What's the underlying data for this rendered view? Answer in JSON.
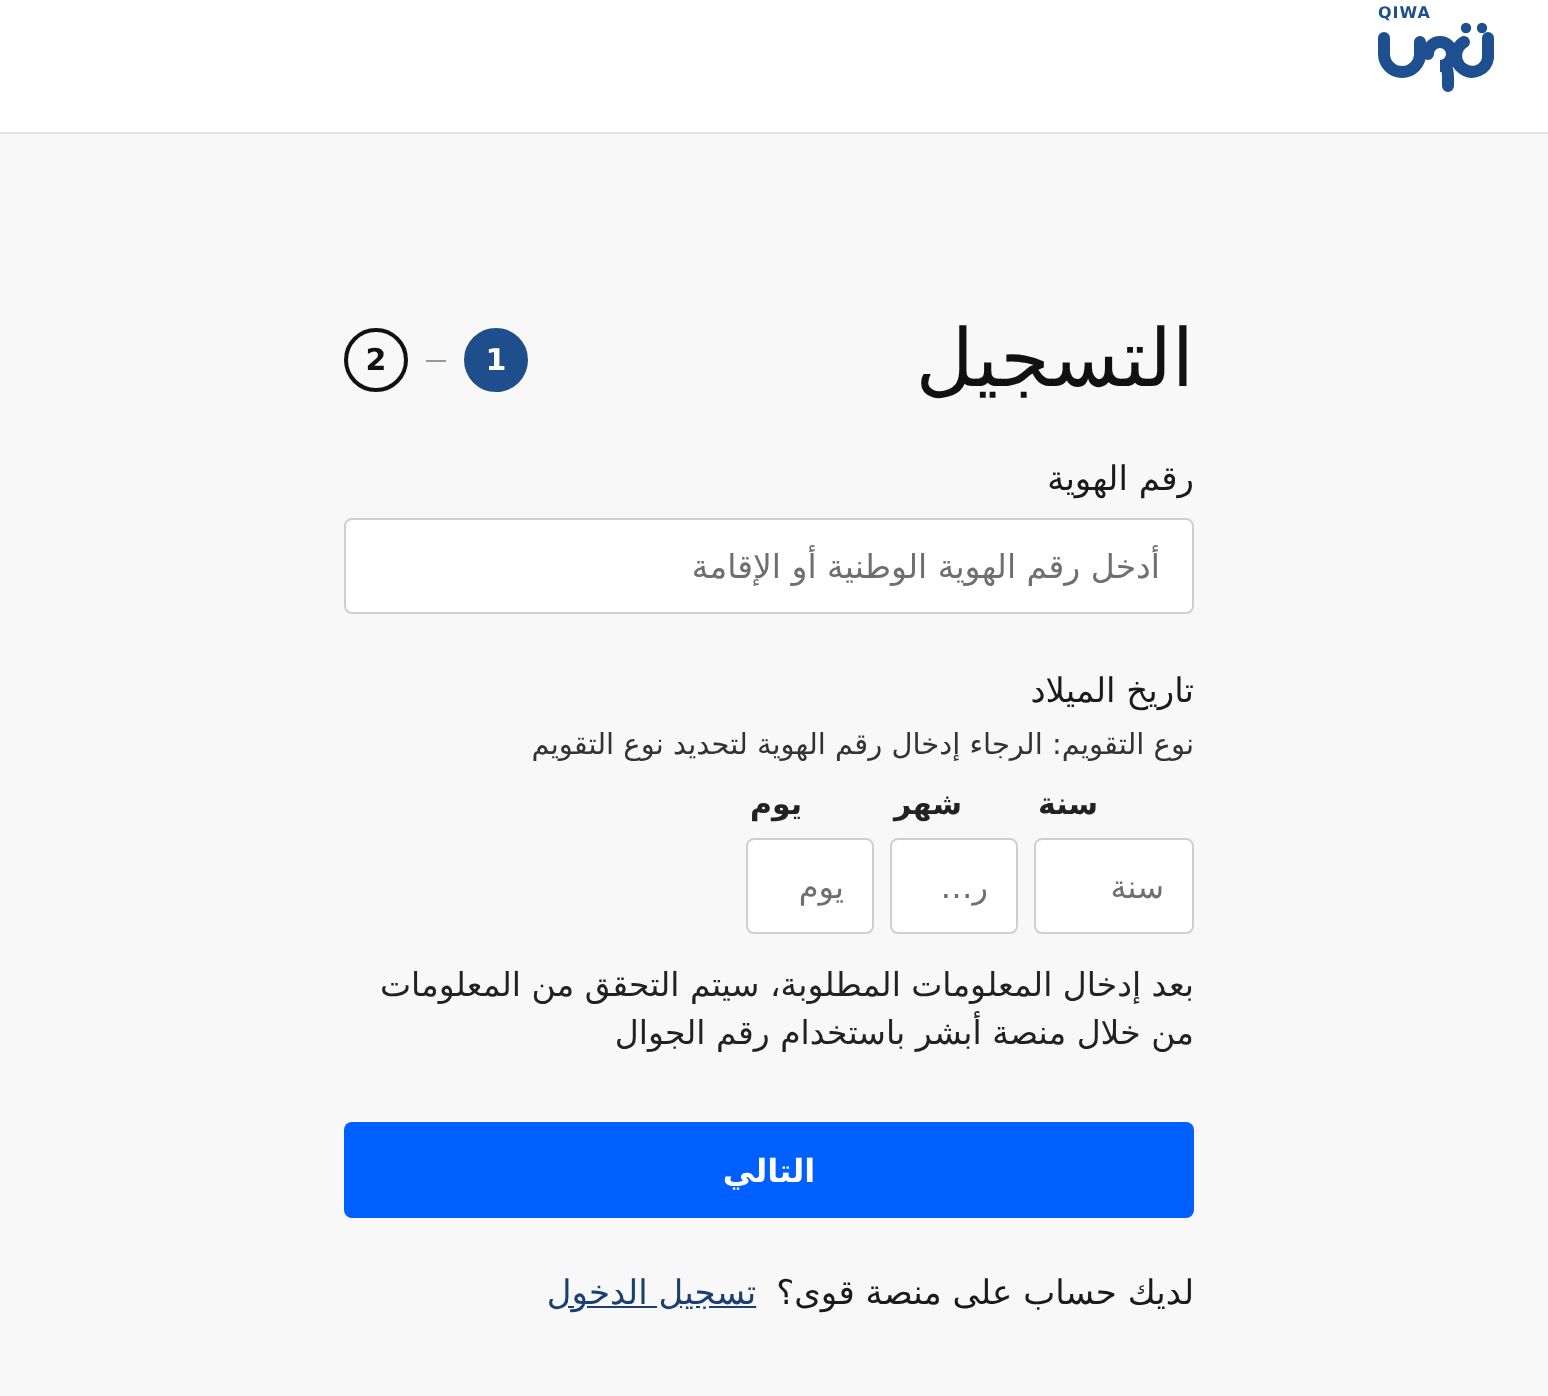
{
  "header": {
    "logo_text": "QIWA"
  },
  "title": "التسجيل",
  "steps": [
    {
      "label": "1",
      "selected": true
    },
    {
      "label": "2",
      "selected": false
    }
  ],
  "id_field": {
    "label": "رقم الهوية",
    "placeholder": "أدخل رقم الهوية الوطنية أو الإقامة"
  },
  "birth_date": {
    "label": "تاريخ الميلاد",
    "hint": "نوع التقويم: الرجاء إدخال رقم الهوية لتحديد نوع التقويم",
    "fields": [
      {
        "kind": "year",
        "label": "سنة",
        "placeholder": "سنة"
      },
      {
        "kind": "month",
        "label": "شهر",
        "placeholder": "ر…"
      },
      {
        "kind": "day",
        "label": "يوم",
        "placeholder": "يوم"
      }
    ]
  },
  "notice": "بعد إدخال المعلومات المطلوبة، سيتم التحقق من المعلومات من خلال منصة أبشر باستخدام رقم الجوال",
  "next_button": "التالي",
  "login_prompt": {
    "text": "لديك حساب على منصة قوى؟",
    "link": "تسجيل الدخول"
  }
}
